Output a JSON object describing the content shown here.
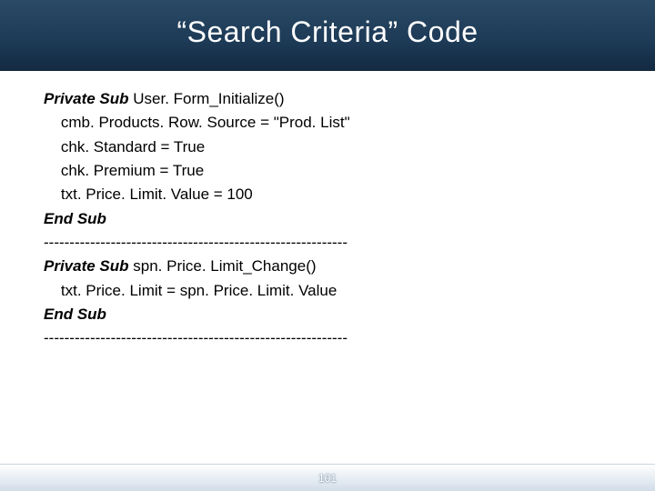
{
  "title": "“Search Criteria” Code",
  "code": {
    "block1": {
      "l1_a": "Private Sub ",
      "l1_b": "User. Form_Initialize()",
      "l2": "    cmb. Products. Row. Source = \"Prod. List\"",
      "l3": "    chk. Standard = True",
      "l4": "    chk. Premium = True",
      "l5": "    txt. Price. Limit. Value = 100",
      "l6": "End Sub"
    },
    "sep1": "-----------------------------------------------------------",
    "block2": {
      "l1_a": "Private Sub ",
      "l1_b": "spn. Price. Limit_Change()",
      "l2": "    txt. Price. Limit = spn. Price. Limit. Value",
      "l3": "End Sub"
    },
    "sep2": "-----------------------------------------------------------"
  },
  "page_number": "101"
}
